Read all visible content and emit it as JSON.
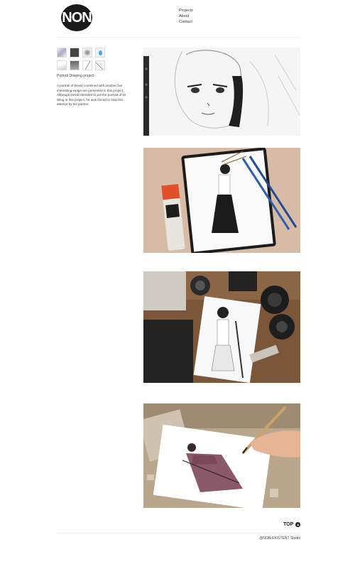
{
  "brand": {
    "logo_text": "NON"
  },
  "nav": {
    "items": [
      {
        "label": "Projects"
      },
      {
        "label": "About"
      },
      {
        "label": "Contact"
      }
    ]
  },
  "project": {
    "title": "Portrait Drawing project",
    "description": "A portrait of Devid combined with another five interesting image are presented in this project. Although Devid intended to put the portrait of Oi Wing in this project, he was forced to stop this attempt by his partner."
  },
  "footer": {
    "top_label": "TOP",
    "copyright": "@NON-EXISTENT Studio"
  },
  "colors": {
    "accent": "#1a1a1a",
    "paint_tube": "#e0502a",
    "brush": "#2b5fae",
    "skirt": "#8b5a6a"
  }
}
